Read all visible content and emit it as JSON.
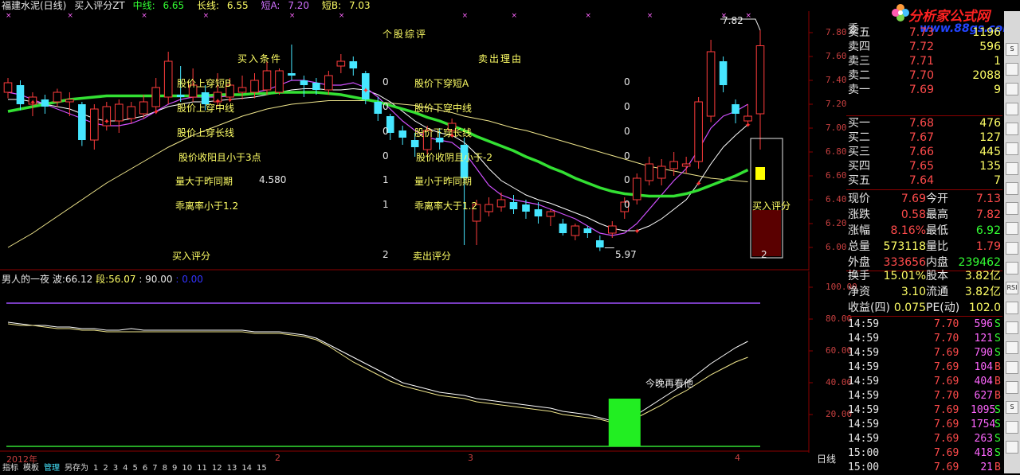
{
  "title": {
    "stock": "福建水泥(日线)",
    "formula": "买入评分ZT",
    "mid_label": "中线:",
    "mid_value": "6.65",
    "long_label": "长线:",
    "long_value": "6.55",
    "shortA_label": "短A:",
    "shortA_value": "7.20",
    "shortB_label": "短B:",
    "shortB_value": "7.03"
  },
  "overlay": {
    "head_center": "个股综评",
    "head_buy": "买入条件",
    "head_sell": "卖出理由",
    "buy_items": [
      "股价上穿短B",
      "股价上穿中线",
      "股价上穿长线",
      "股价收阳且小于3点",
      "量大于昨同期",
      "乖离率小于1.2",
      "买入评分"
    ],
    "buy_values": [
      "0",
      "0",
      "0",
      "0",
      "1",
      "1",
      "2"
    ],
    "buy_extra": "4.580",
    "sell_items": [
      "股价下穿短A",
      "股价下穿中线",
      "股价下穿长线",
      "股价收阴且小于-2",
      "量小于昨同期",
      "乖离率大于1.2",
      "卖出评分"
    ],
    "sell_values": [
      "0",
      "0",
      "0",
      "0",
      "0",
      "0",
      ""
    ],
    "high_mark": "7.82",
    "low_mark": "5.97",
    "buy_score_label": "买入评分",
    "buy_score_value": "2",
    "annotation": "今晚再看他"
  },
  "chart_data": [
    {
      "type": "candlestick",
      "ylim": [
        5.9,
        7.9
      ],
      "yticks": [
        "7.80",
        "7.60",
        "7.40",
        "7.20",
        "7.00",
        "6.80",
        "6.60",
        "6.40",
        "6.20",
        "6.00"
      ],
      "candles": [
        {
          "o": 7.3,
          "c": 7.38,
          "h": 7.42,
          "l": 7.25
        },
        {
          "o": 7.36,
          "c": 7.2,
          "h": 7.4,
          "l": 7.15
        },
        {
          "o": 7.2,
          "c": 7.26,
          "h": 7.3,
          "l": 7.1
        },
        {
          "o": 7.24,
          "c": 7.18,
          "h": 7.28,
          "l": 7.12
        },
        {
          "o": 7.22,
          "c": 7.3,
          "h": 7.33,
          "l": 7.18
        },
        {
          "o": 7.22,
          "c": 7.24,
          "h": 7.3,
          "l": 7.1
        },
        {
          "o": 7.2,
          "c": 6.9,
          "h": 7.22,
          "l": 6.85
        },
        {
          "o": 6.9,
          "c": 7.16,
          "h": 7.2,
          "l": 6.82
        },
        {
          "o": 7.02,
          "c": 7.18,
          "h": 7.22,
          "l": 6.98
        },
        {
          "o": 7.06,
          "c": 7.2,
          "h": 7.24,
          "l": 6.96
        },
        {
          "o": 7.08,
          "c": 7.18,
          "h": 7.22,
          "l": 7.04
        },
        {
          "o": 7.12,
          "c": 7.22,
          "h": 7.28,
          "l": 7.08
        },
        {
          "o": 7.18,
          "c": 7.34,
          "h": 7.42,
          "l": 7.12
        },
        {
          "o": 7.26,
          "c": 7.56,
          "h": 7.64,
          "l": 7.2
        },
        {
          "o": 7.28,
          "c": 7.26,
          "h": 7.52,
          "l": 7.22
        },
        {
          "o": 7.26,
          "c": 7.36,
          "h": 7.5,
          "l": 7.22
        },
        {
          "o": 7.3,
          "c": 7.2,
          "h": 7.36,
          "l": 7.15
        },
        {
          "o": 7.22,
          "c": 7.3,
          "h": 7.46,
          "l": 7.18
        },
        {
          "o": 7.26,
          "c": 7.36,
          "h": 7.42,
          "l": 7.22
        },
        {
          "o": 7.3,
          "c": 7.34,
          "h": 7.44,
          "l": 7.24
        },
        {
          "o": 7.3,
          "c": 7.4,
          "h": 7.46,
          "l": 7.25
        },
        {
          "o": 7.32,
          "c": 7.48,
          "h": 7.56,
          "l": 7.28
        },
        {
          "o": 7.3,
          "c": 7.48,
          "h": 7.5,
          "l": 7.28
        },
        {
          "o": 7.46,
          "c": 7.44,
          "h": 7.7,
          "l": 7.4
        },
        {
          "o": 7.4,
          "c": 7.36,
          "h": 7.44,
          "l": 7.26
        },
        {
          "o": 7.38,
          "c": 7.32,
          "h": 7.42,
          "l": 7.28
        },
        {
          "o": 7.32,
          "c": 7.44,
          "h": 7.48,
          "l": 7.28
        },
        {
          "o": 7.52,
          "c": 7.56,
          "h": 7.62,
          "l": 7.46
        },
        {
          "o": 7.56,
          "c": 7.5,
          "h": 7.6,
          "l": 7.44
        },
        {
          "o": 7.46,
          "c": 7.24,
          "h": 7.48,
          "l": 7.2
        },
        {
          "o": 7.22,
          "c": 7.12,
          "h": 7.26,
          "l": 7.06
        },
        {
          "o": 7.1,
          "c": 6.96,
          "h": 7.12,
          "l": 6.9
        },
        {
          "o": 6.98,
          "c": 6.92,
          "h": 7.02,
          "l": 6.86
        },
        {
          "o": 6.9,
          "c": 6.84,
          "h": 6.96,
          "l": 6.76
        },
        {
          "o": 6.82,
          "c": 6.98,
          "h": 7.02,
          "l": 6.78
        },
        {
          "o": 6.92,
          "c": 6.88,
          "h": 7.0,
          "l": 6.82
        },
        {
          "o": 6.98,
          "c": 7.04,
          "h": 7.08,
          "l": 6.94
        },
        {
          "o": 6.86,
          "c": 6.58,
          "h": 6.92,
          "l": 6.02
        },
        {
          "o": 6.22,
          "c": 6.36,
          "h": 6.4,
          "l": 6.02
        },
        {
          "o": 6.3,
          "c": 6.36,
          "h": 6.42,
          "l": 6.26
        },
        {
          "o": 6.34,
          "c": 6.4,
          "h": 6.46,
          "l": 6.3
        },
        {
          "o": 6.38,
          "c": 6.32,
          "h": 6.44,
          "l": 6.28
        },
        {
          "o": 6.36,
          "c": 6.3,
          "h": 6.4,
          "l": 6.24
        },
        {
          "o": 6.32,
          "c": 6.26,
          "h": 6.38,
          "l": 6.2
        },
        {
          "o": 6.26,
          "c": 6.3,
          "h": 6.32,
          "l": 6.18
        },
        {
          "o": 6.2,
          "c": 6.12,
          "h": 6.24,
          "l": 6.1
        },
        {
          "o": 6.1,
          "c": 6.18,
          "h": 6.2,
          "l": 6.06
        },
        {
          "o": 6.16,
          "c": 6.12,
          "h": 6.18,
          "l": 6.08
        },
        {
          "o": 6.06,
          "c": 6.0,
          "h": 6.1,
          "l": 5.97
        },
        {
          "o": 6.12,
          "c": 6.18,
          "h": 6.22,
          "l": 6.08
        },
        {
          "o": 6.3,
          "c": 6.38,
          "h": 6.42,
          "l": 6.24
        },
        {
          "o": 6.4,
          "c": 6.58,
          "h": 6.62,
          "l": 6.36
        },
        {
          "o": 6.56,
          "c": 6.7,
          "h": 6.76,
          "l": 6.52
        },
        {
          "o": 6.58,
          "c": 6.68,
          "h": 6.74,
          "l": 6.52
        },
        {
          "o": 6.66,
          "c": 6.72,
          "h": 6.8,
          "l": 6.6
        },
        {
          "o": 6.68,
          "c": 6.7,
          "h": 6.76,
          "l": 6.62
        },
        {
          "o": 6.72,
          "c": 7.22,
          "h": 7.26,
          "l": 6.66
        },
        {
          "o": 7.1,
          "c": 7.64,
          "h": 7.74,
          "l": 7.05
        },
        {
          "o": 7.56,
          "c": 7.36,
          "h": 7.6,
          "l": 7.3
        },
        {
          "o": 7.2,
          "c": 7.12,
          "h": 7.24,
          "l": 7.04
        },
        {
          "o": 7.06,
          "c": 7.1,
          "h": 7.2,
          "l": 7.02
        },
        {
          "o": 7.12,
          "c": 7.69,
          "h": 7.82,
          "l": 6.82
        }
      ],
      "lines": {
        "mid": [
          7.14,
          7.16,
          7.18,
          7.2,
          7.22,
          7.24,
          7.25,
          7.26,
          7.27,
          7.27,
          7.27,
          7.27,
          7.27,
          7.27,
          7.27,
          7.27,
          7.27,
          7.28,
          7.28,
          7.28,
          7.29,
          7.29,
          7.3,
          7.3,
          7.3,
          7.3,
          7.29,
          7.28,
          7.26,
          7.24,
          7.22,
          7.19,
          7.16,
          7.13,
          7.09,
          7.06,
          7.02,
          6.98,
          6.93,
          6.89,
          6.85,
          6.81,
          6.76,
          6.72,
          6.67,
          6.63,
          6.58,
          6.54,
          6.5,
          6.47,
          6.45,
          6.44,
          6.43,
          6.43,
          6.43,
          6.45,
          6.48,
          6.52,
          6.56,
          6.6,
          6.65
        ],
        "long": [
          6.0,
          6.06,
          6.12,
          6.19,
          6.26,
          6.33,
          6.4,
          6.47,
          6.54,
          6.6,
          6.66,
          6.72,
          6.78,
          6.84,
          6.89,
          6.94,
          6.98,
          7.02,
          7.06,
          7.1,
          7.13,
          7.16,
          7.18,
          7.2,
          7.21,
          7.22,
          7.23,
          7.23,
          7.23,
          7.23,
          7.22,
          7.21,
          7.2,
          7.19,
          7.17,
          7.15,
          7.13,
          7.1,
          7.08,
          7.06,
          7.03,
          7.0,
          6.98,
          6.95,
          6.92,
          6.89,
          6.86,
          6.83,
          6.8,
          6.77,
          6.74,
          6.71,
          6.68,
          6.66,
          6.64,
          6.62,
          6.6,
          6.58,
          6.57,
          6.56,
          6.55
        ],
        "shortA": [
          7.3,
          7.28,
          7.24,
          7.2,
          7.16,
          7.12,
          7.08,
          7.04,
          7.02,
          7.02,
          7.04,
          7.08,
          7.14,
          7.2,
          7.24,
          7.26,
          7.26,
          7.26,
          7.27,
          7.28,
          7.3,
          7.32,
          7.36,
          7.4,
          7.4,
          7.38,
          7.36,
          7.36,
          7.38,
          7.34,
          7.26,
          7.16,
          7.06,
          6.98,
          6.92,
          6.9,
          6.88,
          6.8,
          6.66,
          6.52,
          6.44,
          6.4,
          6.38,
          6.36,
          6.32,
          6.28,
          6.24,
          6.18,
          6.12,
          6.1,
          6.12,
          6.2,
          6.32,
          6.44,
          6.56,
          6.66,
          6.82,
          7.0,
          7.1,
          7.14,
          7.2
        ],
        "shortB": [
          7.24,
          7.24,
          7.22,
          7.2,
          7.18,
          7.16,
          7.12,
          7.08,
          7.06,
          7.06,
          7.08,
          7.1,
          7.14,
          7.18,
          7.2,
          7.22,
          7.22,
          7.23,
          7.24,
          7.25,
          7.26,
          7.28,
          7.3,
          7.32,
          7.33,
          7.33,
          7.32,
          7.32,
          7.33,
          7.32,
          7.28,
          7.22,
          7.14,
          7.06,
          7.0,
          6.96,
          6.94,
          6.88,
          6.78,
          6.66,
          6.56,
          6.5,
          6.44,
          6.4,
          6.37,
          6.33,
          6.29,
          6.25,
          6.2,
          6.16,
          6.14,
          6.14,
          6.18,
          6.24,
          6.32,
          6.4,
          6.54,
          6.7,
          6.84,
          6.94,
          7.03
        ]
      }
    },
    {
      "type": "line",
      "title": "男人的一夜",
      "ylim": [
        0,
        100
      ],
      "yticks": [
        "100.00",
        "80.00",
        "60.00",
        "40.00",
        "20.00"
      ],
      "readouts": {
        "wave_label": "波:",
        "wave": "66.12",
        "seg_label": "段:",
        "seg": "56.07",
        "level_90": ": 90.00",
        "level_0": ": 0.00"
      },
      "series": [
        {
          "name": "波",
          "values": [
            78,
            77,
            76,
            76,
            75,
            75,
            74,
            74,
            73,
            73,
            74,
            73,
            73,
            73,
            73,
            73,
            73,
            73,
            73,
            73,
            72,
            72,
            72,
            71,
            70,
            68,
            64,
            60,
            56,
            52,
            48,
            44,
            40,
            38,
            36,
            34,
            33,
            32,
            30,
            29,
            28,
            27,
            26,
            25,
            24,
            22,
            21,
            20,
            18,
            16,
            17,
            20,
            25,
            30,
            35,
            40,
            46,
            52,
            57,
            62,
            66
          ]
        },
        {
          "name": "段",
          "values": [
            77,
            76,
            76,
            75,
            74,
            74,
            73,
            73,
            72,
            72,
            72,
            72,
            72,
            72,
            72,
            72,
            72,
            72,
            72,
            72,
            71,
            71,
            71,
            70,
            69,
            67,
            63,
            58,
            53,
            49,
            45,
            41,
            38,
            36,
            34,
            32,
            31,
            30,
            28,
            27,
            26,
            25,
            24,
            23,
            22,
            20,
            19,
            18,
            17,
            15,
            16,
            18,
            22,
            26,
            31,
            35,
            40,
            45,
            49,
            53,
            56
          ]
        }
      ]
    }
  ],
  "time_axis": [
    "2012年",
    "2",
    "3",
    "4"
  ],
  "daily_label": "日线",
  "quotes": {
    "ask_label": "委",
    "asks": [
      {
        "label": "卖五",
        "price": "7.73",
        "vol": "1196"
      },
      {
        "label": "卖四",
        "price": "7.72",
        "vol": "596"
      },
      {
        "label": "卖三",
        "price": "7.71",
        "vol": "1"
      },
      {
        "label": "卖二",
        "price": "7.70",
        "vol": "2088"
      },
      {
        "label": "卖一",
        "price": "7.69",
        "vol": "9"
      }
    ],
    "bids": [
      {
        "label": "买一",
        "price": "7.68",
        "vol": "476"
      },
      {
        "label": "买二",
        "price": "7.67",
        "vol": "127"
      },
      {
        "label": "买三",
        "price": "7.66",
        "vol": "445"
      },
      {
        "label": "买四",
        "price": "7.65",
        "vol": "135"
      },
      {
        "label": "买五",
        "price": "7.64",
        "vol": "7"
      }
    ],
    "stats": [
      {
        "k1": "现价",
        "v1": "7.69",
        "k2": "今开",
        "v2": "7.13"
      },
      {
        "k1": "涨跌",
        "v1": "0.58",
        "k2": "最高",
        "v2": "7.82"
      },
      {
        "k1": "涨幅",
        "v1": "8.16%",
        "k2": "最低",
        "v2": "6.92"
      },
      {
        "k1": "总量",
        "v1": "573118",
        "k2": "量比",
        "v2": "1.79"
      },
      {
        "k1": "外盘",
        "v1": "333656",
        "k2": "内盘",
        "v2": "239462"
      }
    ],
    "fundamentals": [
      {
        "k1": "换手",
        "v1": "15.01%",
        "k2": "股本",
        "v2": "3.82亿"
      },
      {
        "k1": "净资",
        "v1": "3.10",
        "k2": "流通",
        "v2": "3.82亿"
      },
      {
        "k1": "收益(四)",
        "v1": "0.075",
        "k2": "PE(动)",
        "v2": "102.0"
      }
    ],
    "ticks": [
      {
        "time": "14:59",
        "price": "7.70",
        "vol": "596",
        "flag": "S"
      },
      {
        "time": "14:59",
        "price": "7.70",
        "vol": "121",
        "flag": "S"
      },
      {
        "time": "14:59",
        "price": "7.69",
        "vol": "790",
        "flag": "S"
      },
      {
        "time": "14:59",
        "price": "7.69",
        "vol": "104",
        "flag": "B"
      },
      {
        "time": "14:59",
        "price": "7.69",
        "vol": "404",
        "flag": "B"
      },
      {
        "time": "14:59",
        "price": "7.70",
        "vol": "627",
        "flag": "B"
      },
      {
        "time": "14:59",
        "price": "7.69",
        "vol": "1095",
        "flag": "S"
      },
      {
        "time": "14:59",
        "price": "7.69",
        "vol": "1754",
        "flag": "S"
      },
      {
        "time": "14:59",
        "price": "7.69",
        "vol": "263",
        "flag": "S"
      },
      {
        "time": "15:00",
        "price": "7.69",
        "vol": "418",
        "flag": "S"
      },
      {
        "time": "15:00",
        "price": "7.69",
        "vol": "21",
        "flag": "B"
      }
    ]
  },
  "brand": {
    "name": "分析家公式网",
    "url": "www.88gs.com"
  },
  "bottom_tabs": [
    "指标",
    "模板",
    "管理",
    "另存为"
  ],
  "bottom_numbers": [
    "1",
    "2",
    "3",
    "4",
    "5",
    "6",
    "7",
    "8",
    "9",
    "10",
    "11",
    "12",
    "13",
    "14",
    "15"
  ],
  "sidebar_buttons": [
    "S",
    "",
    "",
    "",
    "",
    "",
    "",
    "",
    "",
    "",
    "",
    "",
    "RSI",
    "",
    "",
    "",
    "",
    "",
    "S",
    "",
    ""
  ],
  "colors": {
    "bg": "#000000",
    "up": "#ff3c3c",
    "down": "#46e6ff",
    "mid": "#33e033",
    "long": "#f0e68c",
    "shortA": "#d050ff",
    "shortB": "#ffffff"
  }
}
